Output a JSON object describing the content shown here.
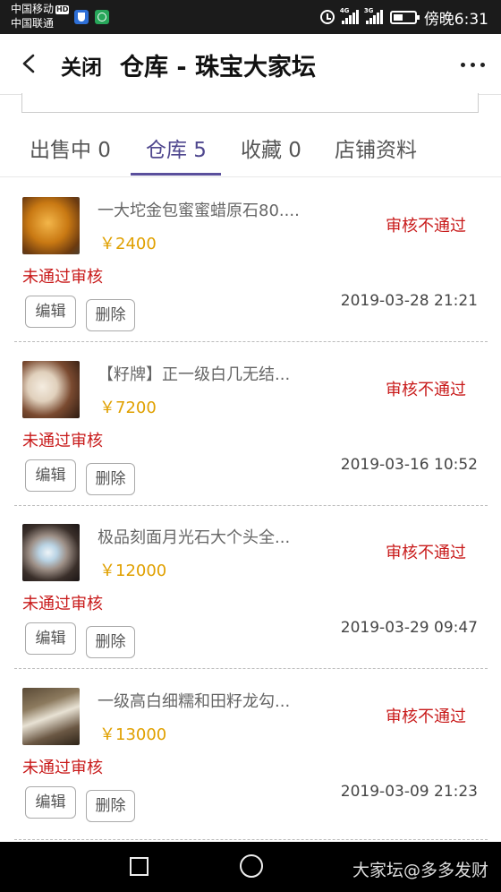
{
  "statusbar": {
    "carrier1": "中国移动",
    "carrier1_badge": "HD",
    "carrier2": "中国联通",
    "net1": "4G",
    "net2": "3G",
    "time": "傍晚6:31",
    "icons": [
      "shield-app-icon",
      "green-app-icon",
      "alarm-icon",
      "signal-icon",
      "battery-icon"
    ]
  },
  "header": {
    "close": "关闭",
    "title": "仓库 - 珠宝大家坛"
  },
  "tabs": [
    {
      "label": "出售中 0"
    },
    {
      "label": "仓库 5"
    },
    {
      "label": "收藏 0"
    },
    {
      "label": "店铺资料"
    }
  ],
  "buttons": {
    "edit": "编辑",
    "delete": "删除"
  },
  "items": [
    {
      "name": "一大坨金包蜜蜜蜡原石80....",
      "price": "￥2400",
      "status": "审核不通过",
      "reject": "未通过审核",
      "time": "2019-03-28 21:21"
    },
    {
      "name": "【籽牌】正一级白几无结...",
      "price": "￥7200",
      "status": "审核不通过",
      "reject": "未通过审核",
      "time": "2019-03-16 10:52"
    },
    {
      "name": "极品刻面月光石大个头全...",
      "price": "￥12000",
      "status": "审核不通过",
      "reject": "未通过审核",
      "time": "2019-03-29 09:47"
    },
    {
      "name": "一级高白细糯和田籽龙勾...",
      "price": "￥13000",
      "status": "审核不通过",
      "reject": "未通过审核",
      "time": "2019-03-09 21:23"
    }
  ],
  "watermark": "大家坛@多多发财",
  "colors": {
    "accent": "#5a4f9c",
    "price": "#e0a000",
    "error": "#c81a1a"
  }
}
